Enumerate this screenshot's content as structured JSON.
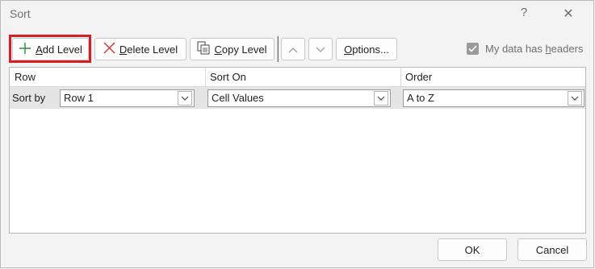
{
  "window": {
    "title": "Sort",
    "help": "?",
    "close": "✕"
  },
  "toolbar": {
    "add_level": {
      "mnemonic": "A",
      "rest": "dd Level"
    },
    "delete_level": {
      "mnemonic": "D",
      "rest": "elete Level"
    },
    "copy_level": {
      "mnemonic": "C",
      "rest": "opy Level"
    },
    "options": {
      "mnemonic": "O",
      "rest": "ptions..."
    },
    "headers_checkbox": {
      "checked": true,
      "label_before": "My data has ",
      "mnemonic": "h",
      "label_after": "eaders"
    }
  },
  "grid": {
    "columns": [
      "Row",
      "Sort On",
      "Order"
    ],
    "rows": [
      {
        "label": "Sort by",
        "row": "Row 1",
        "sort_on": "Cell Values",
        "order": "A to Z"
      }
    ]
  },
  "footer": {
    "ok": "OK",
    "cancel": "Cancel"
  },
  "colors": {
    "highlight": "#d71e27",
    "add_icon": "#2e8b3a",
    "delete_icon": "#d13438"
  }
}
